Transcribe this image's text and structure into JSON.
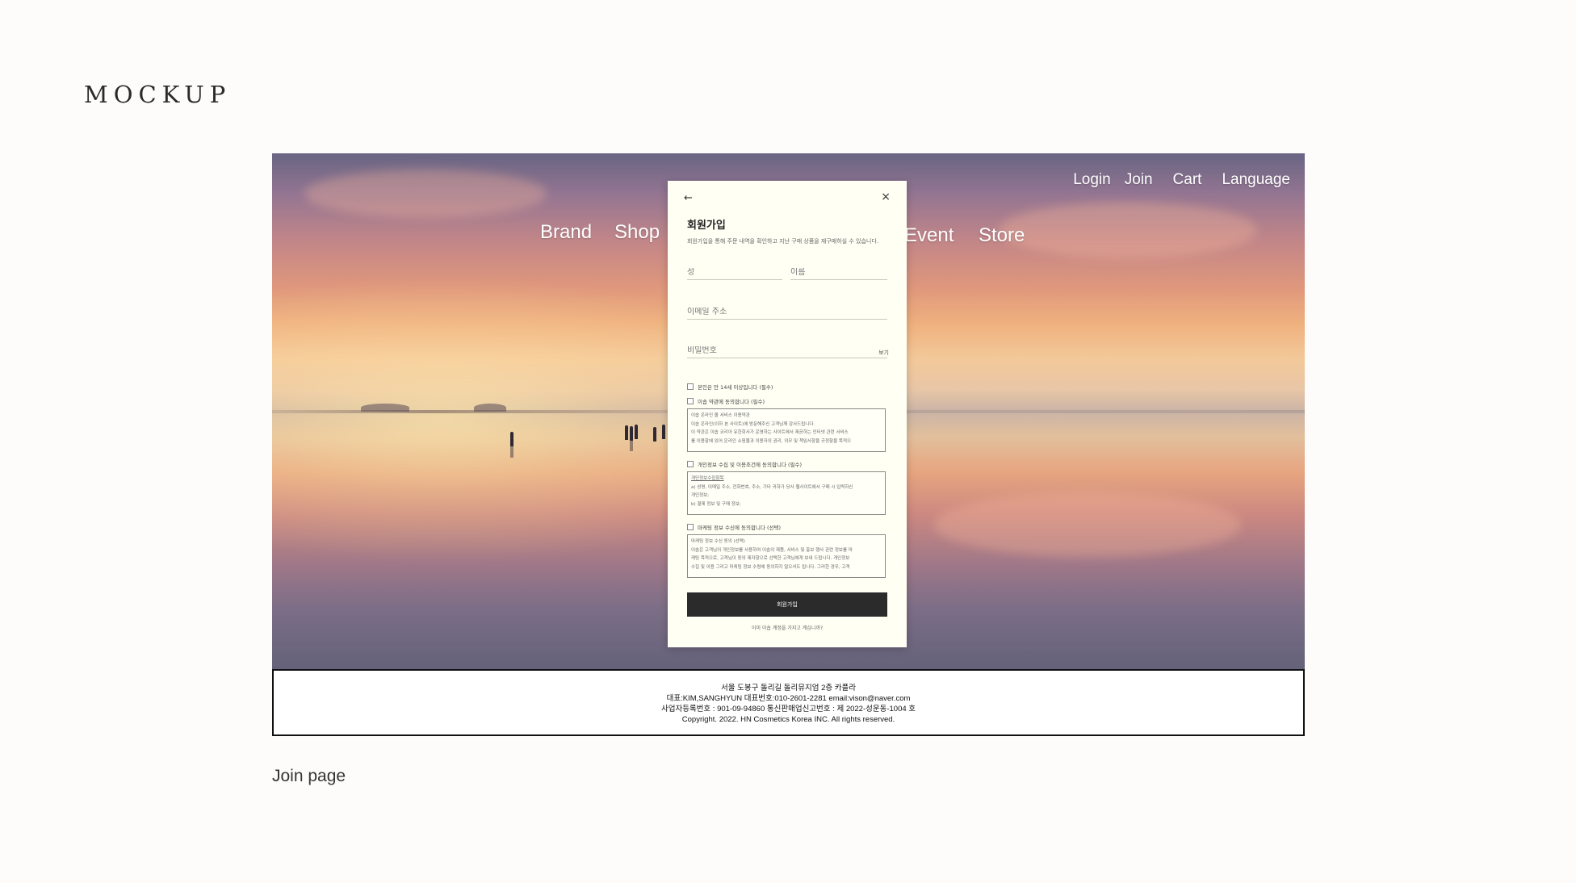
{
  "brand": {
    "logo": "MOCKUP"
  },
  "caption": "Join page",
  "site": {
    "top_nav": [
      "Login",
      "Join",
      "Cart",
      "Language"
    ],
    "main_nav": [
      "Brand",
      "Shop",
      "Event",
      "Store"
    ]
  },
  "modal": {
    "back_icon": "←",
    "close_icon": "×",
    "title": "회원가입",
    "subtitle": "회원가입을 통해 주문 내역을 확인하고 지난 구매 상품을 재구매하실 수 있습니다.",
    "fields": {
      "last_name": "성",
      "first_name": "이름",
      "email": "이메일 주소",
      "password": "비밀번호",
      "show_password": "보기"
    },
    "checks": {
      "age": "본인은 만 14세 이상입니다 (필수)",
      "terms": "이솝 약관에 동의합니다 (필수)",
      "privacy": "개인정보 수집 및 이용조건에 동의합니다 (필수)",
      "marketing": "마케팅 정보 수신에 동의합니다 (선택)"
    },
    "terms_box": [
      "이솝 온라인 몰 서비스 이용약관",
      "이솝 온라인(이하 본 사이트)에 방문해주신 고객님께 감사드립니다.",
      "이 약관은 이솝 코리아 유한회사가 운영하는 사이트에서 제공하는 인터넷 관련 서비스",
      "를 이용함에 있어 온라인 쇼핑몰과 이용자의 권리, 의무 및 책임사항을 규정함을 목적으"
    ],
    "privacy_box": [
      "개인정보수집항목",
      "a) 성명, 이메일 주소, 전화번호, 주소, 기타 귀하가 당사 웹사이트에서 구매 시 입력하신",
      "개인정보;",
      "b) 결제 정보 및 구매 정보;"
    ],
    "marketing_box": [
      "마케팅 정보 수신 동의 (선택)",
      "이솝은 고객님의 개인정보를 사용하여 이솝의 제품, 서비스 및 홍보 행사 관련 정보를 마",
      "케팅 목적으로, 고객님이 동의 제자항으로 선택한 고객님에게 보내 드립니다. 개인정보",
      "수집 및 이용 그리고 마케팅 정보 수령에 동의하지 않으셔도 됩니다. 그러한 경우, 고객"
    ],
    "submit": "회원가입",
    "login_link": "이미 이솝 계정을 가지고 계십니까?"
  },
  "footer": {
    "lines": [
      "서울 도봉구 돌리길 돌리뮤지엄 2층 카플라",
      "대표:KIM,SANGHYUN  대표번호:010-2601-2281 email:vison@naver.com",
      "사업자등록번호 : 901-09-94860  통신판매업신고번호 : 제 2022-성운동-1004 호",
      "Copyright. 2022. HN Cosmetics Korea INC. All rights reserved."
    ]
  }
}
